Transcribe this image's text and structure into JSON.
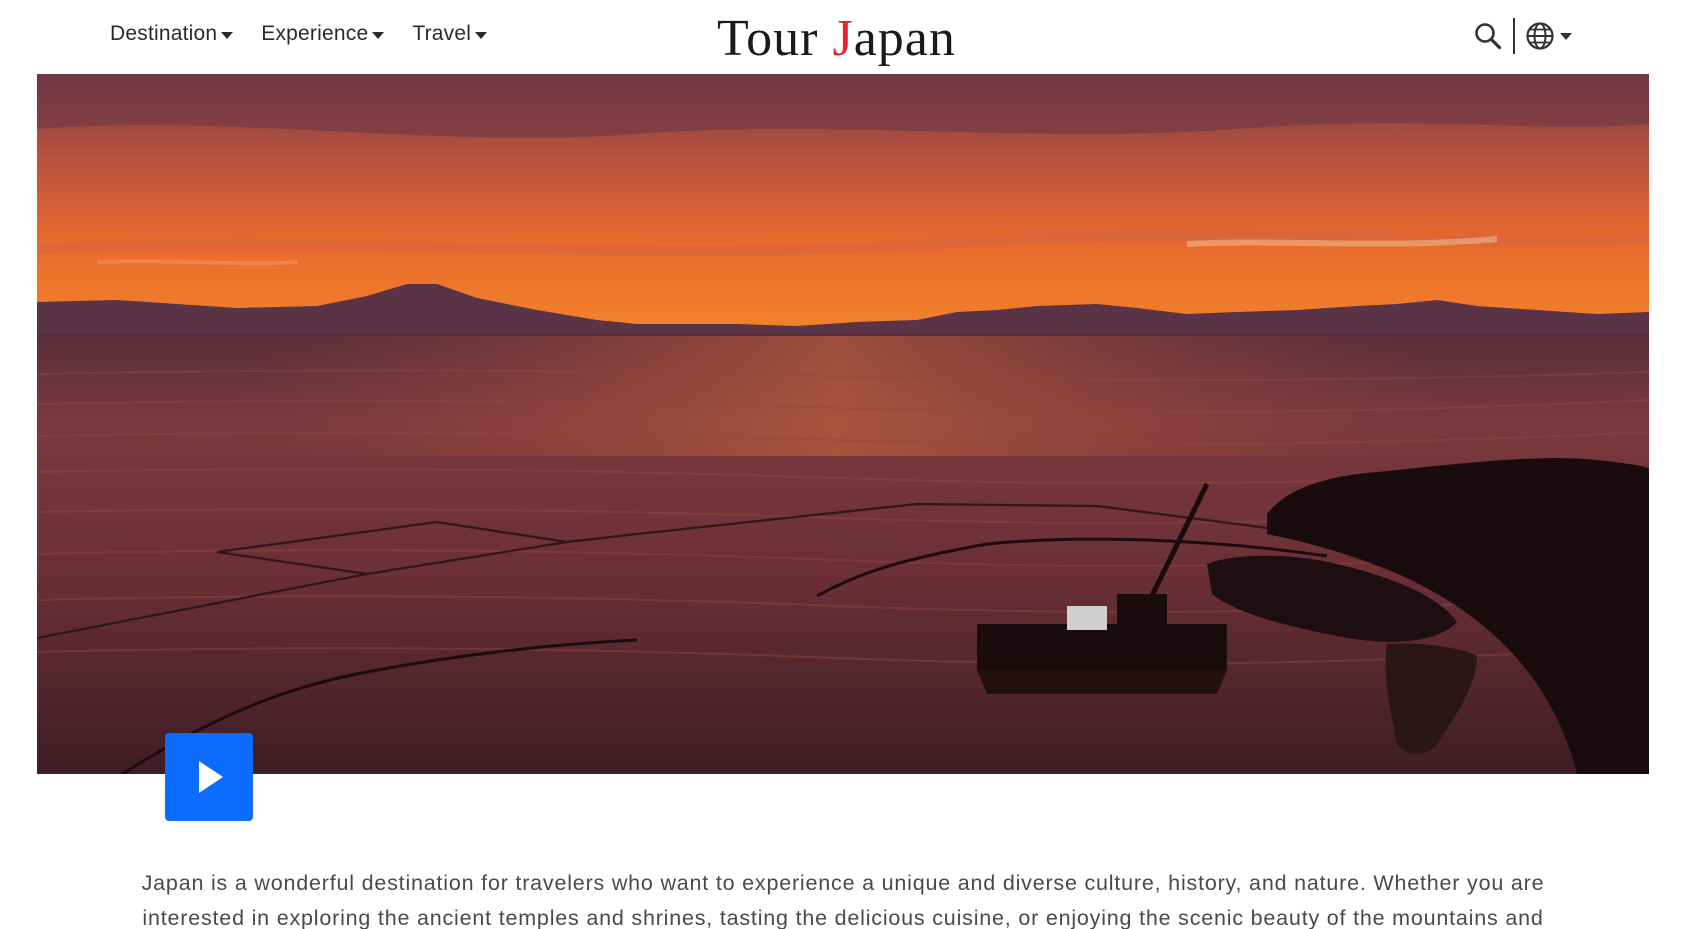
{
  "header": {
    "nav": [
      {
        "label": "Destination"
      },
      {
        "label": "Experience"
      },
      {
        "label": "Travel"
      }
    ],
    "logo": {
      "part1": "Tour ",
      "accent": "J",
      "part2": "apan"
    },
    "icons": {
      "search": "search-icon",
      "language": "globe-icon"
    }
  },
  "hero": {
    "image_description_icon": "sunset-lake-video",
    "play_icon": "play-icon",
    "colors": {
      "play_button": "#0b6cff"
    }
  },
  "intro": {
    "text": "Japan is a wonderful destination for travelers who want to experience a unique and diverse culture, history, and nature. Whether you are interested in exploring the ancient temples and shrines, tasting the delicious cuisine, or enjoying the scenic beauty of the mountains and"
  },
  "colors": {
    "accent": "#e8212a",
    "text": "#4a4a4a"
  }
}
